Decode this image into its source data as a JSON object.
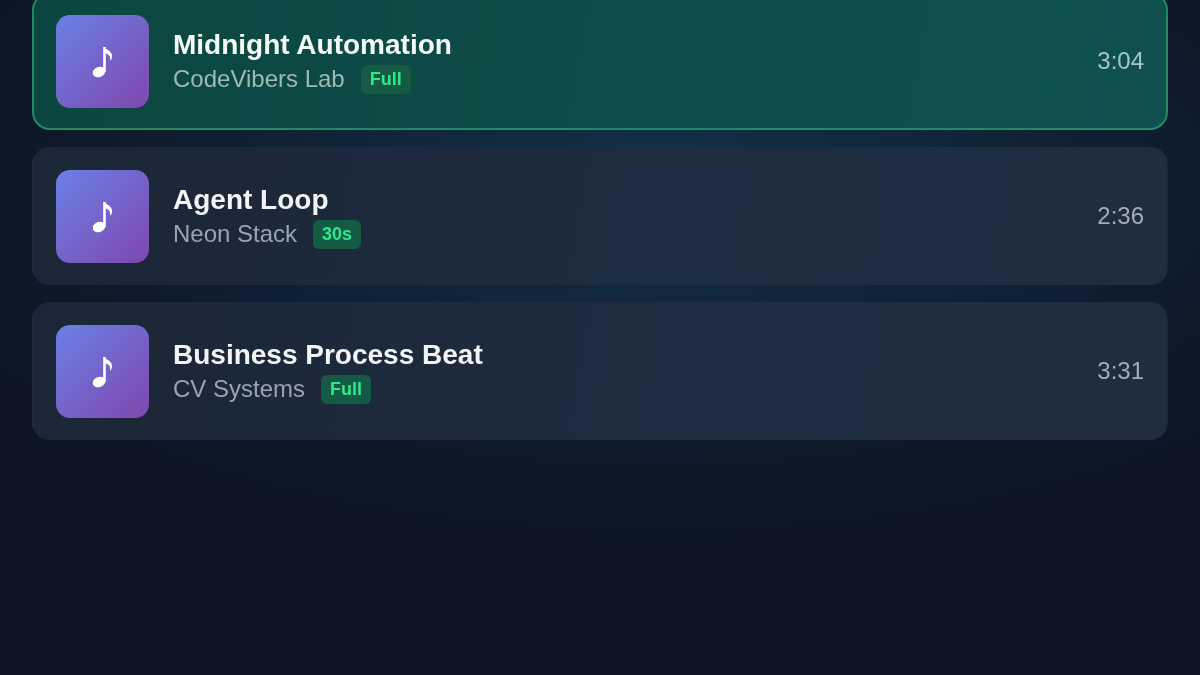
{
  "tracks": [
    {
      "title": "Midnight Automation",
      "artist": "CodeVibers Lab",
      "badge": "Full",
      "duration": "3:04",
      "selected": true
    },
    {
      "title": "Agent Loop",
      "artist": "Neon Stack",
      "badge": "30s",
      "duration": "2:36",
      "selected": false
    },
    {
      "title": "Business Process Beat",
      "artist": "CV Systems",
      "badge": "Full",
      "duration": "3:31",
      "selected": false
    }
  ]
}
